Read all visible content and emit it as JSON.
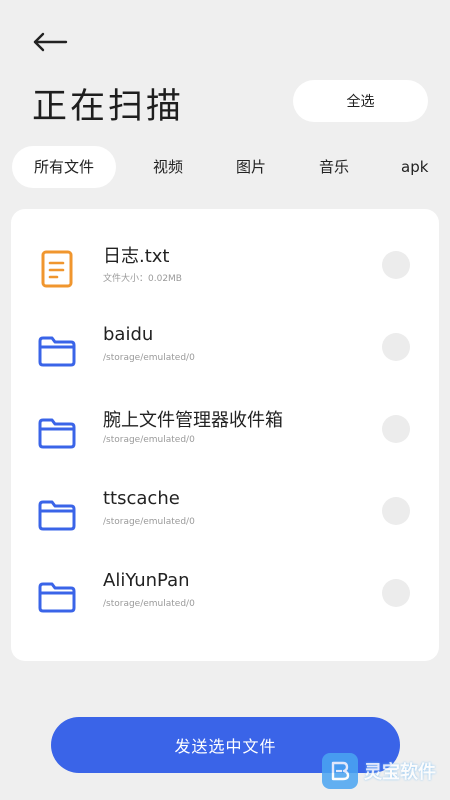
{
  "header": {
    "back_icon": "arrow-left-icon",
    "title": "正在扫描",
    "select_all_label": "全选"
  },
  "tabs": [
    {
      "label": "所有文件",
      "active": true
    },
    {
      "label": "视频",
      "active": false
    },
    {
      "label": "图片",
      "active": false
    },
    {
      "label": "音乐",
      "active": false
    },
    {
      "label": "apk",
      "active": false
    }
  ],
  "files": [
    {
      "name": "日志.txt",
      "sub": "文件大小：0.02MB",
      "icon": "text-file-icon",
      "icon_color": "#f0962e",
      "checked": false
    },
    {
      "name": "baidu",
      "sub": "/storage/emulated/0",
      "icon": "folder-icon",
      "icon_color": "#3a64e8",
      "checked": false
    },
    {
      "name": "腕上文件管理器收件箱",
      "sub": "/storage/emulated/0",
      "icon": "folder-icon",
      "icon_color": "#3a64e8",
      "checked": false
    },
    {
      "name": "ttscache",
      "sub": "/storage/emulated/0",
      "icon": "folder-icon",
      "icon_color": "#3a64e8",
      "checked": false
    },
    {
      "name": "AliYunPan",
      "sub": "/storage/emulated/0",
      "icon": "folder-icon",
      "icon_color": "#3a64e8",
      "checked": false
    }
  ],
  "footer": {
    "send_label": "发送选中文件"
  },
  "watermark": {
    "text": "灵宝软件"
  },
  "colors": {
    "accent": "#3a64e8",
    "text_file": "#f0962e",
    "background": "#efefef",
    "card": "#ffffff"
  }
}
